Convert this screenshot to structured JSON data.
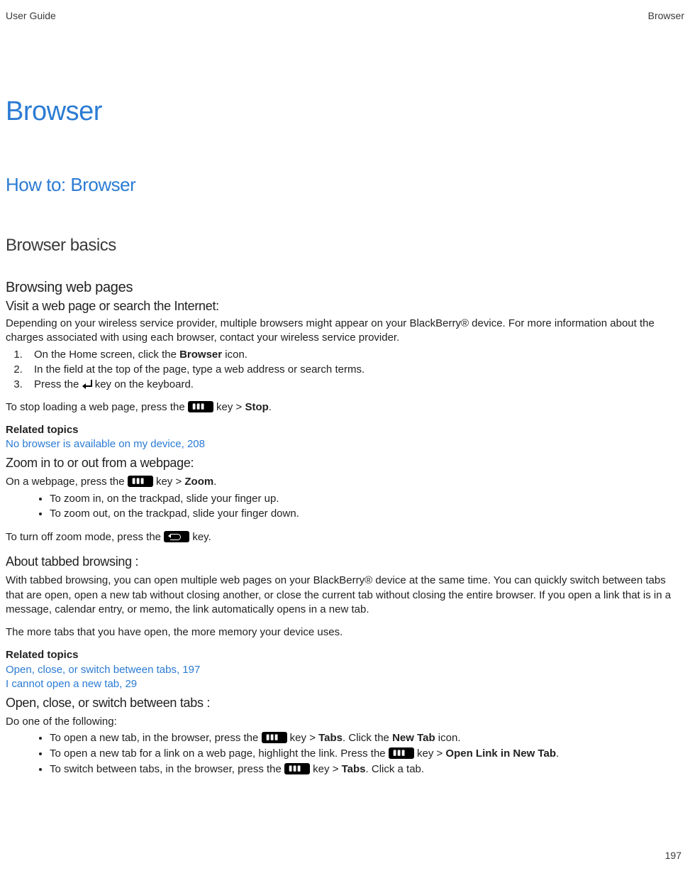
{
  "header": {
    "left": "User Guide",
    "right": "Browser"
  },
  "h1": "Browser",
  "h2": "How to: Browser",
  "h3": "Browser basics",
  "sec1": {
    "h4": "Browsing web pages",
    "h5": "Visit a web page or search the Internet:",
    "intro": "Depending on your wireless service provider, multiple browsers might appear on your BlackBerry® device. For more information about the charges associated with using each browser, contact your wireless service provider.",
    "step1_pre": "On the Home screen, click the ",
    "step1_bold": "Browser",
    "step1_post": " icon.",
    "step2": "In the field at the top of the page, type a web address or search terms.",
    "step3_pre": "Press the ",
    "step3_post": " key on the keyboard.",
    "stop_pre": "To stop loading a web page, press the ",
    "stop_mid": " key > ",
    "stop_bold": "Stop",
    "stop_post": ".",
    "related_label": "Related topics",
    "related_link": "No browser is available on my device, 208"
  },
  "sec2": {
    "h5": "Zoom in to or out from a webpage:",
    "p1_pre": "On a webpage, press the ",
    "p1_mid": " key > ",
    "p1_bold": "Zoom",
    "p1_post": ".",
    "bul1": "To zoom in, on the trackpad, slide your finger up.",
    "bul2": "To zoom out, on the trackpad, slide your finger down.",
    "off_pre": "To turn off zoom mode, press the ",
    "off_post": " key."
  },
  "sec3": {
    "h5": "About tabbed browsing :",
    "p1": "With tabbed browsing, you can open multiple web pages on your BlackBerry® device at the same time. You can quickly switch between tabs that are open, open a new tab without closing another, or close the current tab without closing the entire browser. If you open a link that is in a message, calendar entry, or memo, the link automatically opens in a new tab.",
    "p2": "The more tabs that you have open, the more memory your device uses.",
    "related_label": "Related topics",
    "related_link1": "Open, close, or switch between tabs, 197",
    "related_link2": "I cannot open a new tab, 29"
  },
  "sec4": {
    "h5": "Open, close, or switch between tabs :",
    "intro": "Do one of the following:",
    "b1_pre": "To open a new tab, in the browser, press the ",
    "b1_mid": " key > ",
    "b1_bold1": "Tabs",
    "b1_mid2": ". Click the ",
    "b1_bold2": "New Tab",
    "b1_post": " icon.",
    "b2_pre": "To open a new tab for a link on a web page, highlight the link. Press the ",
    "b2_mid": " key > ",
    "b2_bold": "Open Link in New Tab",
    "b2_post": ".",
    "b3_pre": "To switch between tabs, in the browser, press the ",
    "b3_mid": " key > ",
    "b3_bold": "Tabs",
    "b3_post": ". Click a tab."
  },
  "footer": {
    "page": "197"
  }
}
